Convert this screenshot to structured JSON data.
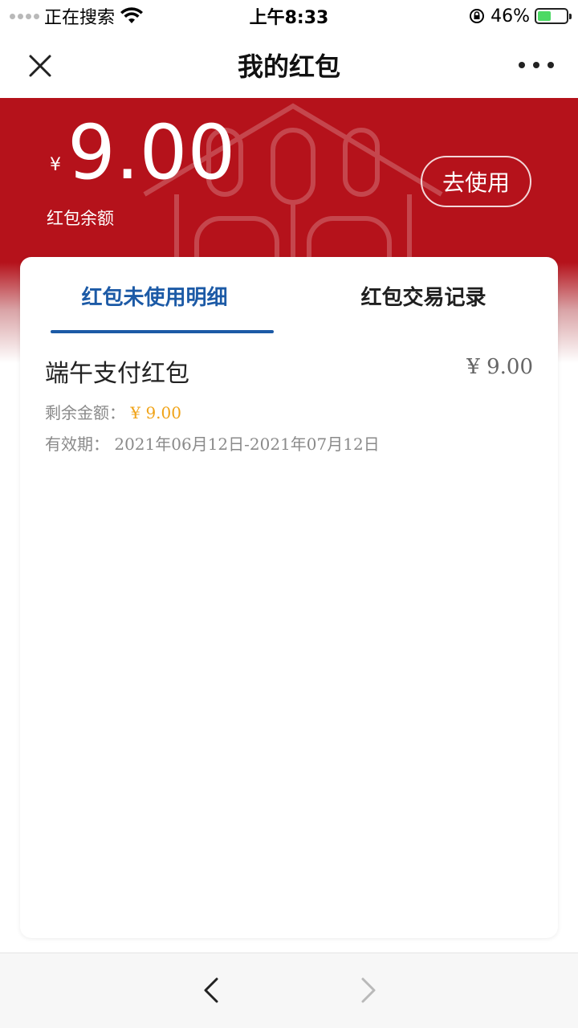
{
  "status_bar": {
    "carrier": "正在搜索",
    "time": "上午8:33",
    "battery_percent": "46%",
    "battery_level": 0.46
  },
  "nav": {
    "title": "我的红包",
    "close_icon": "close-icon",
    "more_icon": "more-icon"
  },
  "balance": {
    "currency": "¥",
    "amount": "9.00",
    "label": "红包余额",
    "use_button": "去使用"
  },
  "tabs": [
    {
      "label": "红包未使用明细",
      "active": true
    },
    {
      "label": "红包交易记录",
      "active": false
    }
  ],
  "packets": [
    {
      "title": "端午支付红包",
      "amount": "¥ 9.00",
      "remaining_label": "剩余金额：",
      "remaining_value": "¥ 9.00",
      "validity_label": "有效期：",
      "validity_value": "2021年06月12日-2021年07月12日"
    }
  ],
  "colors": {
    "header_red": "#b5121b",
    "accent_blue": "#1c5aa6",
    "amount_orange": "#f0a318"
  }
}
